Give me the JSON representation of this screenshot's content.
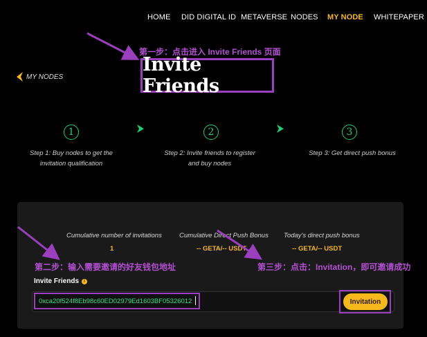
{
  "nav": {
    "items": [
      {
        "label": "HOME",
        "active": false
      },
      {
        "label": "DID DIGITAL ID",
        "active": false
      },
      {
        "label": "METAVERSE",
        "active": false
      },
      {
        "label": "NODES",
        "active": false
      },
      {
        "label": "MY NODE",
        "active": true
      },
      {
        "label": "WHITEPAPER",
        "active": false
      }
    ]
  },
  "annotations": {
    "step1": "第一步：点击进入 Invite Friends 页面",
    "step2": "第二步：输入需要邀请的好友钱包地址",
    "step3": "第三步：点击：Invitation，即可邀请成功"
  },
  "back": {
    "label": "MY NODES",
    "icon": "chevron-left-icon"
  },
  "page_title": "Invite Friends",
  "steps": [
    {
      "num": "1",
      "line1": "Step 1: Buy nodes to get the",
      "line2": "invitation qualification"
    },
    {
      "num": "2",
      "line1": "Step 2: Invite friends to register",
      "line2": "and buy nodes"
    },
    {
      "num": "3",
      "line1": "Step 3: Get direct push bonus",
      "line2": ""
    }
  ],
  "stats": [
    {
      "label": "Cumulative number of invitations",
      "value": "1"
    },
    {
      "label": "Cumulative Direct Push Bonus",
      "value": "-- GETA/-- USDT"
    },
    {
      "label": "Today's direct push bonus",
      "value": "-- GETA/-- USDT"
    }
  ],
  "invite": {
    "label": "Invite Friends",
    "info_icon": "i",
    "address": "0xca20f524f8Eb98c60ED02979Ed1603BF05326012",
    "button": "Invitation"
  },
  "colors": {
    "accent": "#f6b81a",
    "annotation": "#9c3fbf",
    "step_green": "#1dcf77",
    "address_green": "#2fe08a",
    "panel": "#1a1a1a"
  }
}
